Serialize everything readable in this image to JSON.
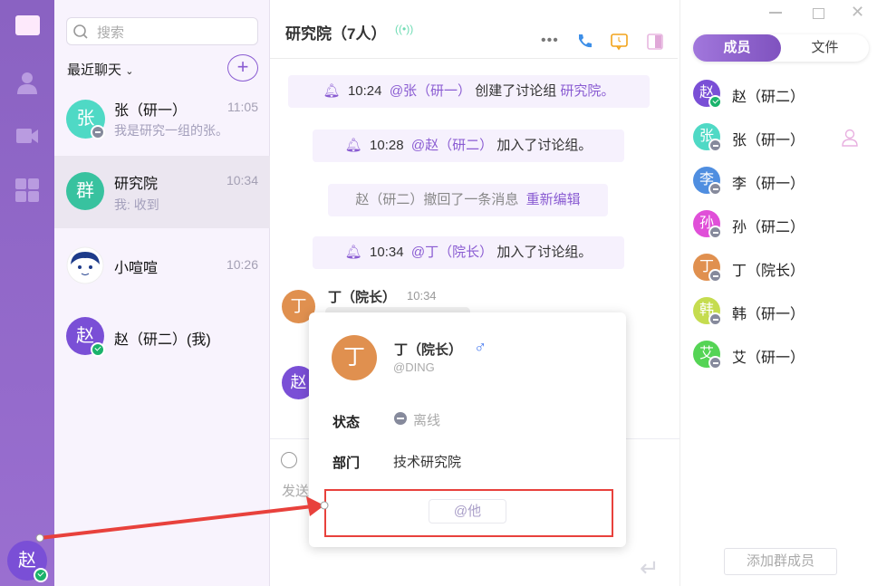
{
  "rail": {
    "user_avatar": "赵",
    "icons": [
      "chat-icon",
      "contacts-icon",
      "video-icon",
      "apps-icon"
    ]
  },
  "list": {
    "search_placeholder": "搜索",
    "section": "最近聊天",
    "add": "+",
    "items": [
      {
        "avatar": "张",
        "color": "#4fd9c5",
        "name": "张（研一）",
        "time": "11:05",
        "preview": "我是研究一组的张。",
        "status": "offline"
      },
      {
        "avatar": "群",
        "color": "#38c29f",
        "name": "研究院",
        "time": "10:34",
        "preview": "我: 收到",
        "status": ""
      },
      {
        "avatar": "",
        "color": "#fff",
        "name": "小喧喧",
        "time": "10:26",
        "preview": "",
        "status": ""
      },
      {
        "avatar": "赵",
        "color": "#7a4fd6",
        "name": "赵（研二）(我)",
        "time": "",
        "preview": "",
        "status": "online"
      }
    ]
  },
  "chat": {
    "title": "研究院（7人）",
    "sys1": {
      "time": "10:24",
      "user": "@张（研一）",
      "text": "创建了讨论组",
      "group": "研究院。"
    },
    "sys2": {
      "time": "10:28",
      "user": "@赵（研二）",
      "text": "加入了讨论组。"
    },
    "recall": {
      "text": "赵（研二）撤回了一条消息",
      "action": "重新编辑"
    },
    "sys3": {
      "time": "10:34",
      "user": "@丁（院长）",
      "text": "加入了讨论组。"
    },
    "msg": {
      "avatar": "丁",
      "name": "丁（院长）",
      "time": "10:34"
    },
    "msg2_avatar": "赵",
    "input_placeholder": "发送"
  },
  "popup": {
    "avatar": "丁",
    "name": "丁（院长）",
    "gender": "♂",
    "account": "@DING",
    "status_label": "状态",
    "status": "离线",
    "dept_label": "部门",
    "dept": "技术研究院",
    "at_button": "@他"
  },
  "right": {
    "tab_members": "成员",
    "tab_files": "文件",
    "add_member": "添加群成员",
    "members": [
      {
        "avatar": "赵",
        "color": "#7a4fd6",
        "name": "赵（研二）",
        "status": "online"
      },
      {
        "avatar": "张",
        "color": "#4fd9c5",
        "name": "张（研一）",
        "status": "offline"
      },
      {
        "avatar": "李",
        "color": "#4f8ee0",
        "name": "李（研一）",
        "status": "offline"
      },
      {
        "avatar": "孙",
        "color": "#e04fd8",
        "name": "孙（研二）",
        "status": "offline"
      },
      {
        "avatar": "丁",
        "color": "#e0904f",
        "name": "丁（院长）",
        "status": "offline"
      },
      {
        "avatar": "韩",
        "color": "#c5dc4f",
        "name": "韩（研一）",
        "status": "offline"
      },
      {
        "avatar": "艾",
        "color": "#55d455",
        "name": "艾（研一）",
        "status": "offline"
      }
    ]
  }
}
